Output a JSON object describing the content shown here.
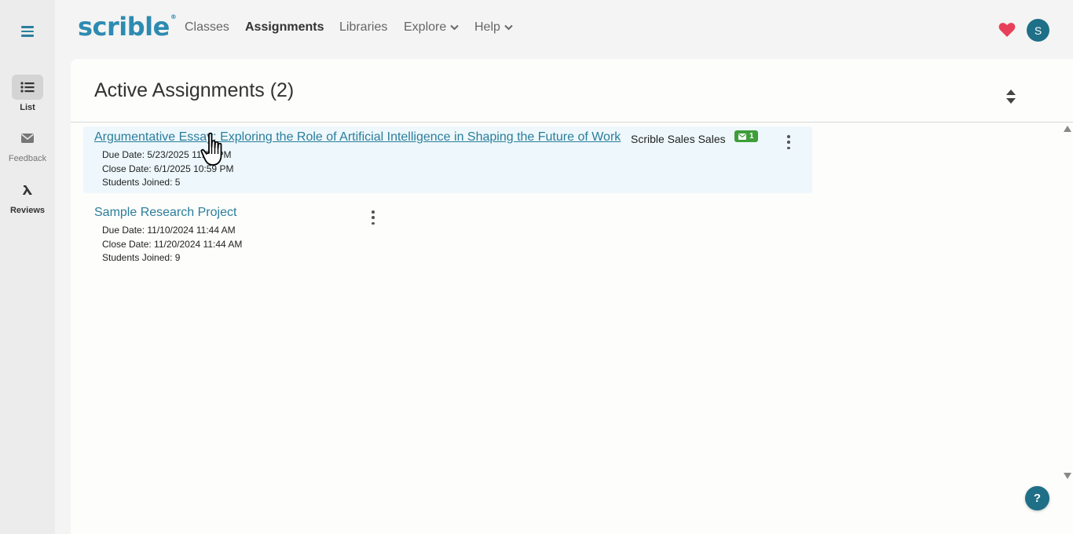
{
  "app": {
    "logo": "scrible",
    "logo_mark": "®"
  },
  "rail": {
    "items": [
      {
        "label": "List",
        "icon": "list-icon",
        "active": true
      },
      {
        "label": "Feedback",
        "icon": "envelope-icon",
        "active": false
      },
      {
        "label": "Reviews",
        "icon": "lambda-icon",
        "active": false
      }
    ]
  },
  "nav": {
    "links": [
      {
        "label": "Classes"
      },
      {
        "label": "Assignments",
        "active": true
      },
      {
        "label": "Libraries"
      },
      {
        "label": "Explore"
      },
      {
        "label": "Help"
      }
    ],
    "avatar_initial": "S"
  },
  "main": {
    "title": "Active Assignments (2)",
    "assignments": [
      {
        "title": "Argumentative Essay: Exploring the Role of Artificial Intelligence in Shaping the Future of Work",
        "author": "Scrible Sales Sales",
        "badge_count": "1",
        "due": "Due Date: 5/23/2025 11:59 PM",
        "close": "Close Date: 6/1/2025 10:59 PM",
        "students": "Students Joined: 5"
      },
      {
        "title": "Sample Research Project",
        "due": "Due Date: 11/10/2024 11:44 AM",
        "close": "Close Date: 11/20/2024 11:44 AM",
        "students": "Students Joined: 9"
      }
    ]
  },
  "help_fab": "?",
  "colors": {
    "brand": "#2d8bb1",
    "link": "#2b7d9b",
    "avatar": "#1e6f87",
    "badge": "#3f9d3a",
    "heart": "#e8405a"
  }
}
